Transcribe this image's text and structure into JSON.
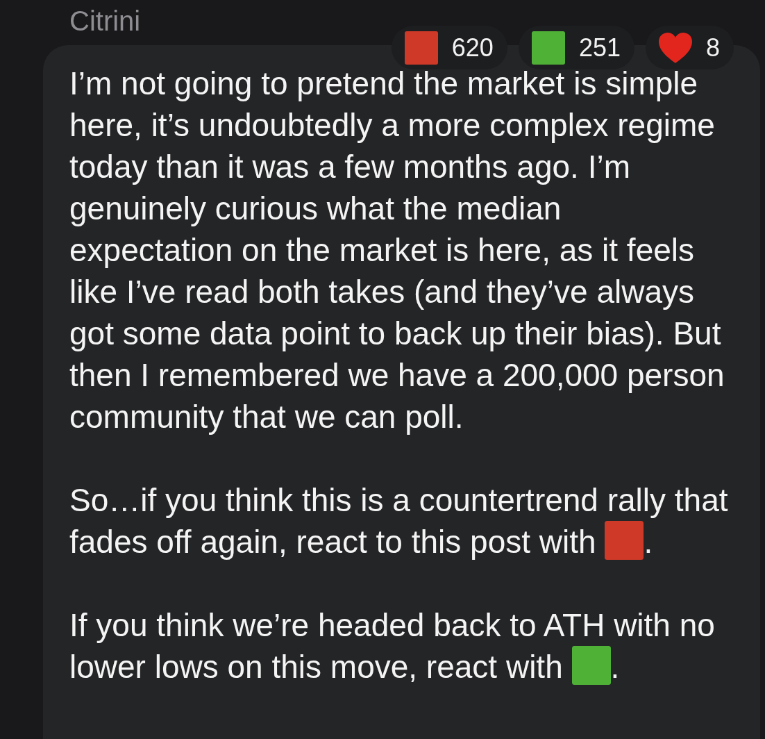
{
  "message": {
    "author": "Citrini",
    "reactions": [
      {
        "kind": "square",
        "color": "#cf3a28",
        "count": "620"
      },
      {
        "kind": "square",
        "color": "#4fb236",
        "count": "251"
      },
      {
        "kind": "heart",
        "color": "#e2261d",
        "count": "8"
      }
    ],
    "paragraphs": [
      {
        "text": "I’m not going to pretend the market is simple here, it’s undoubtedly a more complex regime today than it was a few months ago. I’m genuinely curious what the median expectation on the market is here, as it feels like I’ve read both takes (and they’ve always got some data point to back up their bias). But then I remembered we have a 200,000 person community that we can poll."
      },
      {
        "text": "So…if you think this is a countertrend rally that fades off again, react to this post with",
        "emoji": {
          "kind": "square",
          "color": "#cf3a28"
        },
        "after": "."
      },
      {
        "text": "If you think we’re headed back to ATH with no lower lows on this move, react with",
        "emoji": {
          "kind": "square",
          "color": "#4fb236"
        },
        "after": "."
      }
    ]
  }
}
